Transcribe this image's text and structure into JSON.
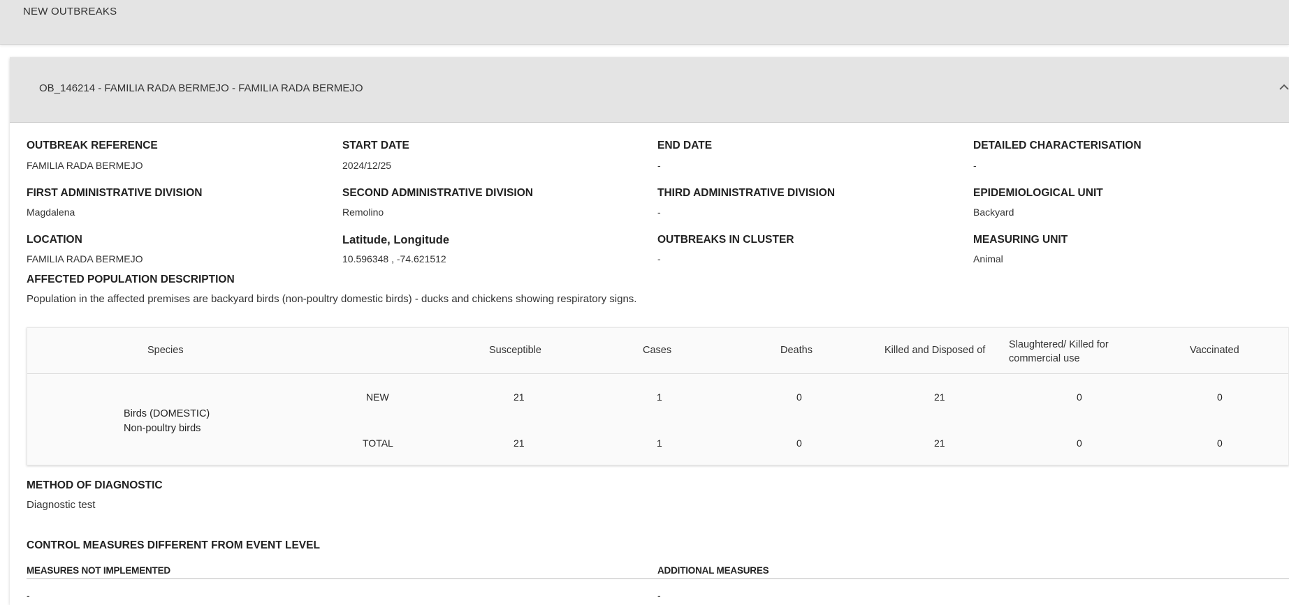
{
  "page": {
    "title": "NEW OUTBREAKS"
  },
  "outbreak": {
    "header_title": "OB_146214 - FAMILIA RADA BERMEJO - FAMILIA RADA BERMEJO",
    "fields": {
      "outbreak_reference": {
        "label": "OUTBREAK REFERENCE",
        "value": "FAMILIA RADA BERMEJO"
      },
      "start_date": {
        "label": "START DATE",
        "value": "2024/12/25"
      },
      "end_date": {
        "label": "END DATE",
        "value": "-"
      },
      "detailed_characterisation": {
        "label": "DETAILED CHARACTERISATION",
        "value": "-"
      },
      "first_admin_division": {
        "label": "FIRST ADMINISTRATIVE DIVISION",
        "value": "Magdalena"
      },
      "second_admin_division": {
        "label": "SECOND ADMINISTRATIVE DIVISION",
        "value": "Remolino"
      },
      "third_admin_division": {
        "label": "THIRD ADMINISTRATIVE DIVISION",
        "value": "-"
      },
      "epidemiological_unit": {
        "label": "EPIDEMIOLOGICAL UNIT",
        "value": "Backyard"
      },
      "location": {
        "label": "LOCATION",
        "value": "FAMILIA RADA BERMEJO"
      },
      "lat_long": {
        "label": "Latitude, Longitude",
        "value": "10.596348 , -74.621512"
      },
      "outbreaks_in_cluster": {
        "label": "OUTBREAKS IN CLUSTER",
        "value": "-"
      },
      "measuring_unit": {
        "label": "MEASURING UNIT",
        "value": "Animal"
      }
    },
    "affected_population": {
      "label": "AFFECTED POPULATION DESCRIPTION",
      "text": "Population in the affected premises are backyard birds (non-poultry domestic birds) - ducks and chickens showing respiratory signs."
    },
    "species_table": {
      "columns": {
        "species": "Species",
        "susceptible": "Susceptible",
        "cases": "Cases",
        "deaths": "Deaths",
        "killed_disposed": "Killed and Disposed of",
        "slaughtered_line1": "Slaughtered/ Killed for",
        "slaughtered_line2": "commercial use",
        "vaccinated": "Vaccinated"
      },
      "species_line1": "Birds (DOMESTIC)",
      "species_line2": "Non-poultry birds",
      "rows": [
        {
          "type": "NEW",
          "susceptible": "21",
          "cases": "1",
          "deaths": "0",
          "killed_disposed": "21",
          "slaughtered": "0",
          "vaccinated": "0"
        },
        {
          "type": "TOTAL",
          "susceptible": "21",
          "cases": "1",
          "deaths": "0",
          "killed_disposed": "21",
          "slaughtered": "0",
          "vaccinated": "0"
        }
      ]
    },
    "method_of_diagnostic": {
      "label": "METHOD OF DIAGNOSTIC",
      "value": "Diagnostic test"
    },
    "control_measures": {
      "label": "CONTROL MEASURES DIFFERENT FROM EVENT LEVEL",
      "not_implemented": {
        "label": "MEASURES NOT IMPLEMENTED",
        "value": "-"
      },
      "additional": {
        "label": "ADDITIONAL MEASURES",
        "value": "-"
      }
    }
  }
}
